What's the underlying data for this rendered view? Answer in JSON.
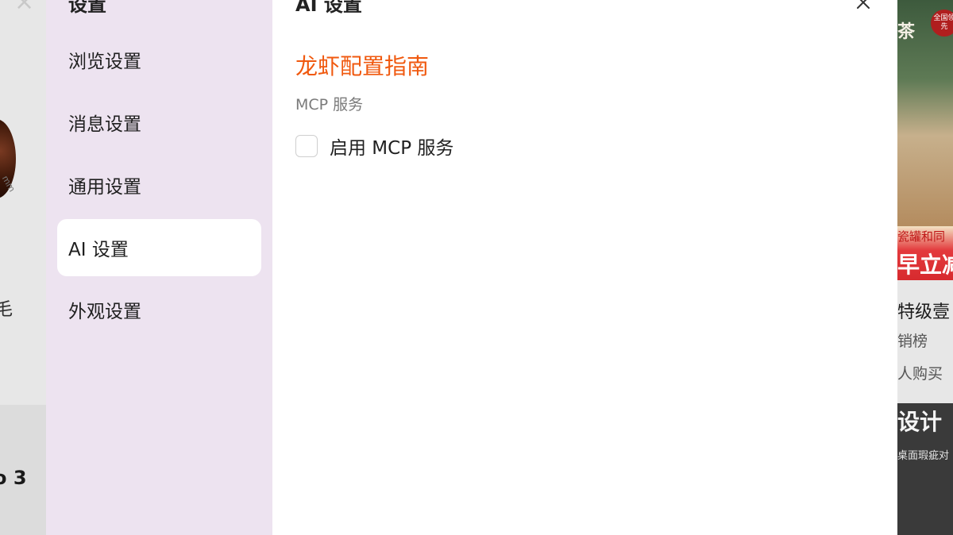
{
  "background": {
    "left": {
      "product_size_fragment": "mm",
      "fragment_glyph": "毛",
      "product_fragment": "o 3"
    },
    "right": {
      "tea_label": "茶",
      "badge_text": "全国领先",
      "promo_line_1": "瓷罐和同",
      "promo_line_2": "早立减",
      "product_title_fragment": "特级壹",
      "rank_fragment": "销榜",
      "buyers_fragment": "人购买",
      "design_fragment": "设计",
      "desc_fragment": "桌面瑕疵对"
    }
  },
  "modal": {
    "sidebar": {
      "title": "设置",
      "items": [
        {
          "label": "浏览设置",
          "active": false
        },
        {
          "label": "消息设置",
          "active": false
        },
        {
          "label": "通用设置",
          "active": false
        },
        {
          "label": "AI 设置",
          "active": true
        },
        {
          "label": "外观设置",
          "active": false
        }
      ]
    },
    "content": {
      "title": "AI 设置",
      "guide_link": "龙虾配置指南",
      "section_label": "MCP 服务",
      "checkbox_label": "启用 MCP 服务",
      "checkbox_checked": false,
      "close_icon": "close-icon"
    }
  },
  "colors": {
    "accent_orange": "#f0590f",
    "sidebar_bg": "#ede3f0",
    "active_item_bg": "#ffffff"
  }
}
